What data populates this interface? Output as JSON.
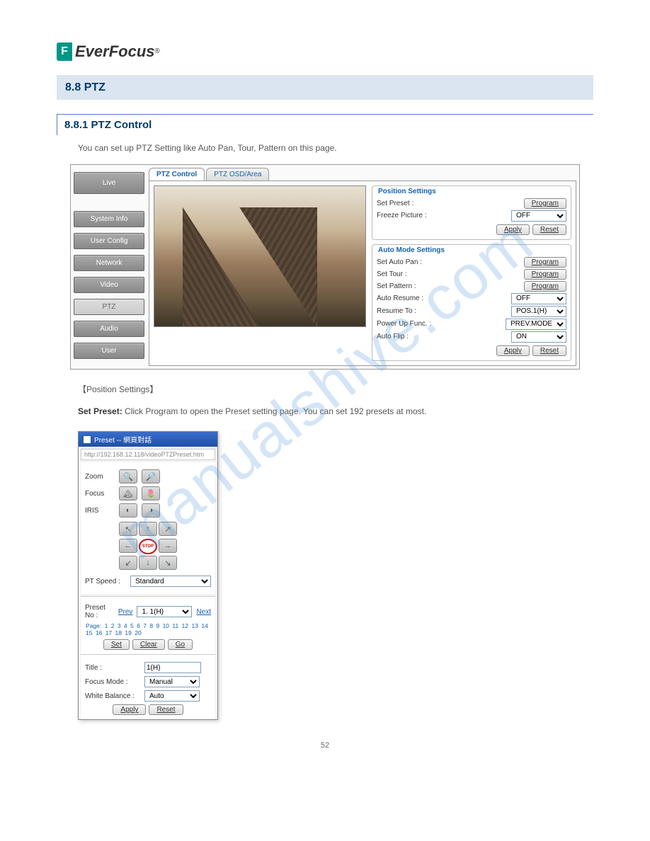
{
  "logo_text": "EverFocus",
  "logo_r": "®",
  "header": "8.8 PTZ",
  "section_title": "8.8.1 PTZ Control",
  "intro": "You can set up PTZ Setting like Auto Pan, Tour, Pattern on this page.",
  "watermark": "manualshive.com",
  "sidebar": [
    "Live",
    "System Info",
    "User Config",
    "Network",
    "Video",
    "PTZ",
    "Audio",
    "User"
  ],
  "tabs": [
    "PTZ Control",
    "PTZ OSD/Area"
  ],
  "position_settings": {
    "legend": "Position Settings",
    "set_preset": {
      "label": "Set Preset :",
      "btn": "Program"
    },
    "freeze": {
      "label": "Freeze Picture :",
      "value": "OFF"
    },
    "apply": "Apply",
    "reset": "Reset"
  },
  "auto_mode": {
    "legend": "Auto Mode Settings",
    "auto_pan": {
      "label": "Set Auto Pan :",
      "btn": "Program"
    },
    "set_tour": {
      "label": "Set Tour :",
      "btn": "Program"
    },
    "set_pattern": {
      "label": "Set Pattern :",
      "btn": "Program"
    },
    "auto_resume": {
      "label": "Auto Resume :",
      "value": "OFF"
    },
    "resume_to": {
      "label": "Resume To :",
      "value": "POS.1(H)"
    },
    "power_up": {
      "label": "Power Up Func. :",
      "value": "PREV.MODE"
    },
    "auto_flip": {
      "label": "Auto Flip :",
      "value": "ON"
    },
    "apply": "Apply",
    "reset": "Reset"
  },
  "pos_title": "【Position Settings】",
  "preset_explain_label": "Set Preset:",
  "preset_explain": "Click Program to open the Preset setting page. You can set 192 presets at most.",
  "popup": {
    "title": "Preset -- 網頁對話",
    "url": "http://192.168.12.118/videoPTZPreset.htm",
    "zoom": "Zoom",
    "focus": "Focus",
    "iris": "IRIS",
    "pt_speed_label": "PT Speed :",
    "pt_speed_value": "Standard",
    "preset_no_label": "Preset No :",
    "prev": "Prev",
    "preset_value": "1. 1(H)",
    "next": "Next",
    "page_label": "Page:",
    "pages": [
      "1",
      "2",
      "3",
      "4",
      "5",
      "6",
      "7",
      "8",
      "9",
      "10",
      "11",
      "12",
      "13",
      "14",
      "15",
      "16",
      "17",
      "18",
      "19",
      "20"
    ],
    "set": "Set",
    "clear": "Clear",
    "go": "Go",
    "title_label": "Title :",
    "title_value": "1(H)",
    "focus_mode_label": "Focus Mode :",
    "focus_mode_value": "Manual",
    "wb_label": "White Balance :",
    "wb_value": "Auto",
    "apply": "Apply",
    "reset": "Reset"
  },
  "page_num": "52"
}
